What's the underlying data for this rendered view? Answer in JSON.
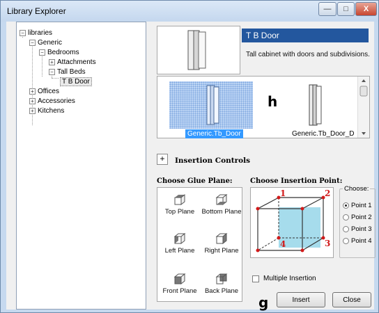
{
  "window": {
    "title": "Library Explorer",
    "minimize_glyph": "—",
    "maximize_glyph": "□",
    "close_glyph": "X"
  },
  "tree": {
    "items": [
      {
        "label": "libraries",
        "toggle": "−"
      },
      {
        "label": "Generic",
        "toggle": "−"
      },
      {
        "label": "Bedrooms",
        "toggle": "−"
      },
      {
        "label": "Attachments",
        "toggle": "+"
      },
      {
        "label": "Tall Beds",
        "toggle": "−"
      },
      {
        "label": "T B Door",
        "toggle": ""
      },
      {
        "label": "Offices",
        "toggle": "+"
      },
      {
        "label": "Accessories",
        "toggle": "+"
      },
      {
        "label": "Kitchens",
        "toggle": "+"
      }
    ]
  },
  "details": {
    "title": "T B Door",
    "description": "Tall cabinet with doors and subdivisions."
  },
  "gallery": {
    "items": [
      {
        "caption": "Generic.Tb_Door"
      },
      {
        "caption": "Generic.Tb_Door_D"
      }
    ]
  },
  "annotations": {
    "h": "h",
    "g": "g"
  },
  "insertion_controls": {
    "expand_glyph": "+",
    "title": "Insertion Controls"
  },
  "glue_plane": {
    "title": "Choose Glue Plane:",
    "options": [
      "Top Plane",
      "Bottom Plane",
      "Left Plane",
      "Right Plane",
      "Front Plane",
      "Back Plane"
    ]
  },
  "insertion_point": {
    "title": "Choose Insertion Point:",
    "points": [
      "1",
      "2",
      "3",
      "4"
    ],
    "choose_label": "Choose:",
    "options": [
      "Point 1",
      "Point 2",
      "Point 3",
      "Point 4"
    ],
    "selected": "Point 1"
  },
  "multiple_insertion": {
    "label": "Multiple Insertion",
    "checked": false
  },
  "buttons": {
    "insert": "Insert",
    "close": "Close"
  },
  "colors": {
    "title_bg": "#23579e",
    "selection": "#3399ff",
    "cube_face": "#a6dcec",
    "point_red": "#d11a1a"
  }
}
